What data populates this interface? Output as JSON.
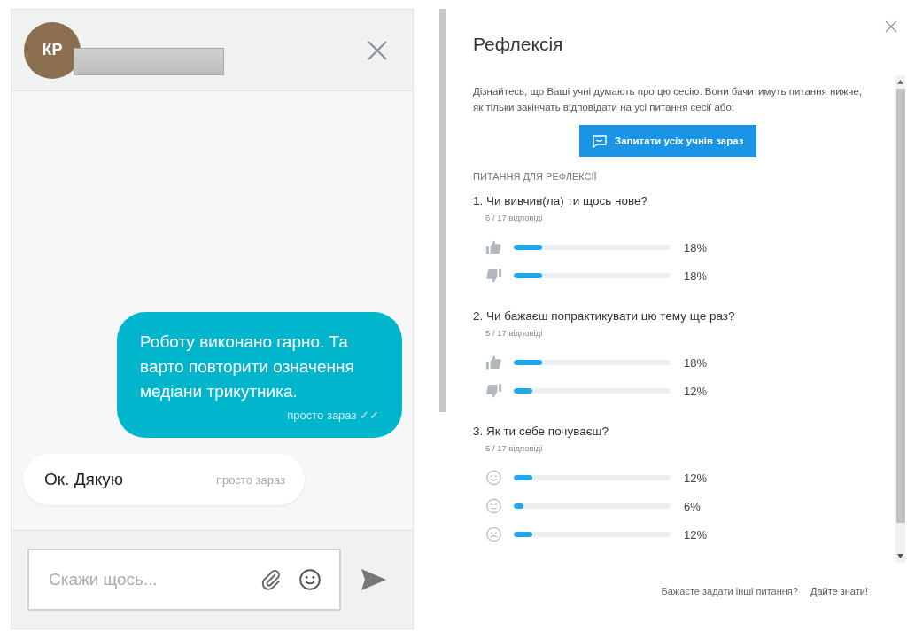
{
  "chat": {
    "avatar": "КР",
    "messages": [
      {
        "kind": "outgoing",
        "text": "Роботу виконано гарно. Та варто повторити означення медіани трикутника.",
        "time": "просто зараз ✓✓"
      },
      {
        "kind": "incoming",
        "text": "Ок. Дякую",
        "time": "просто зараз"
      }
    ],
    "input": {
      "placeholder": "Скажи щось..."
    }
  },
  "reflection": {
    "title": "Рефлексія",
    "description": "Дізнайтесь, що Ваші учні думають про цю сесію. Вони бачитимуть питання нижче, як тільки закінчать відповідати на усі питання сесії або:",
    "ask_button": "Запитати усіх учнів зараз",
    "section_label": "ПИТАННЯ ДЛЯ РЕФЛЕКСІЇ",
    "questions": [
      {
        "title": "1. Чи вивчив(ла) ти щось нове?",
        "responses": "6 / 17 відповіді",
        "answers": [
          {
            "kind": "thumbs-up",
            "level": 0.18,
            "percent": "18%"
          },
          {
            "kind": "thumbs-down",
            "level": 0.18,
            "percent": "18%"
          }
        ]
      },
      {
        "title": "2. Чи бажаєш попрактикувати цю тему ще раз?",
        "responses": "5 / 17 відповіді",
        "answers": [
          {
            "kind": "thumbs-up",
            "level": 0.18,
            "percent": "18%"
          },
          {
            "kind": "thumbs-down",
            "level": 0.12,
            "percent": "12%"
          }
        ]
      },
      {
        "title": "3. Як ти себе почуваєш?",
        "responses": "5 / 17 відповіді",
        "answers": [
          {
            "kind": "happy",
            "level": 0.12,
            "percent": "12%"
          },
          {
            "kind": "neutral",
            "level": 0.06,
            "percent": "6%"
          },
          {
            "kind": "sad",
            "level": 0.12,
            "percent": "12%"
          }
        ]
      }
    ],
    "footer_question": "Бажаєте задати інші питання?",
    "footer_link": "Дайте знати!"
  }
}
